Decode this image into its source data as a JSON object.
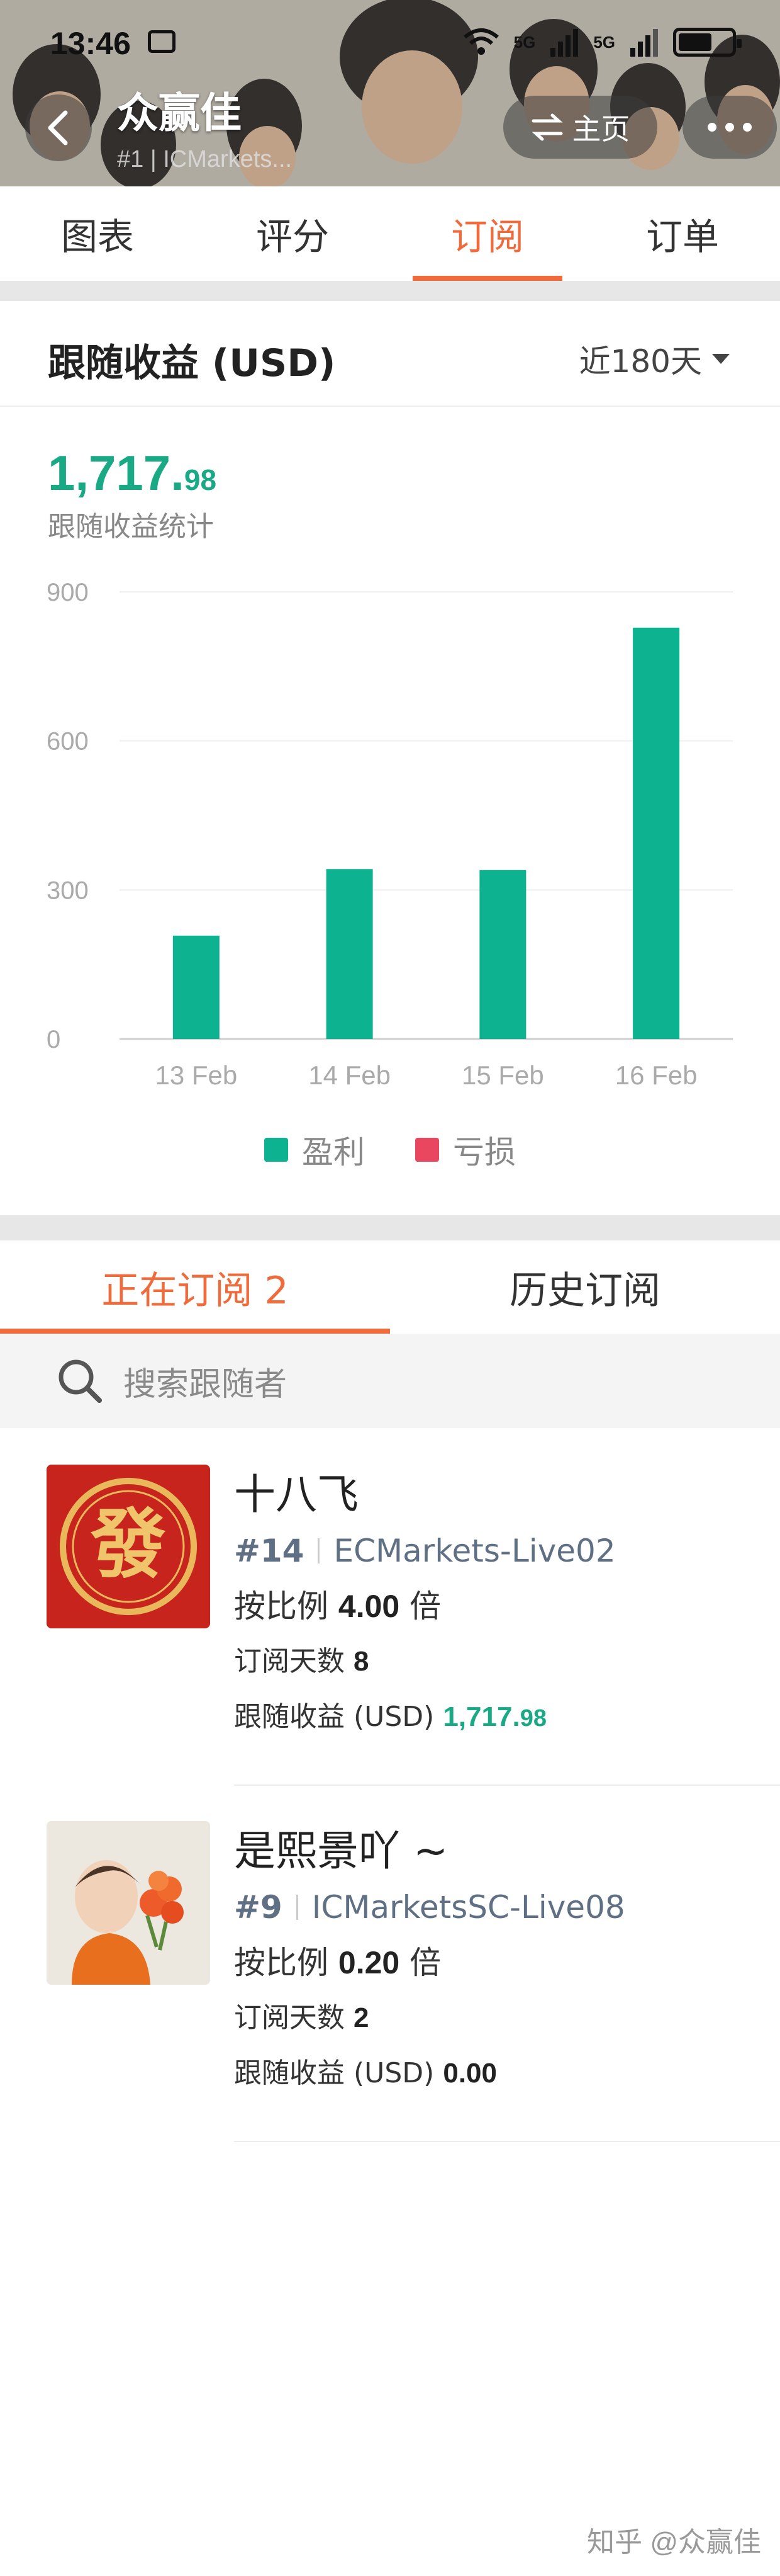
{
  "status_bar": {
    "time": "13:46",
    "network_1": "5G",
    "network_2": "5G"
  },
  "header": {
    "title": "众赢佳",
    "subtitle": "#1 | ICMarkets...",
    "home_label": "主页"
  },
  "tabs": [
    "图表",
    "评分",
    "订阅",
    "订单"
  ],
  "active_tab": 2,
  "earnings": {
    "heading": "跟随收益 (USD)",
    "range": "近180天",
    "total_int": "1,717.",
    "total_dec": "98",
    "total_label": "跟随收益统计"
  },
  "chart_data": {
    "type": "bar",
    "categories": [
      "13 Feb",
      "14 Feb",
      "15 Feb",
      "16 Feb"
    ],
    "series": [
      {
        "name": "盈利",
        "values": [
          208,
          342,
          340,
          828
        ],
        "color": "#0db390"
      },
      {
        "name": "亏损",
        "values": [
          0,
          0,
          0,
          0
        ],
        "color": "#e8475f"
      }
    ],
    "yticks": [
      0,
      300,
      600,
      900
    ],
    "ylim": [
      0,
      900
    ],
    "grid": true,
    "legend": "bottom-center"
  },
  "sub_tabs": {
    "current": "正在订阅 2",
    "history": "历史订阅"
  },
  "search": {
    "placeholder": "搜索跟随者"
  },
  "subscribers": [
    {
      "name": "十八飞",
      "rank": "#14",
      "broker": "ECMarkets-Live02",
      "ratio_label": "按比例",
      "ratio_value": "4.00",
      "ratio_unit": "倍",
      "days_label": "订阅天数",
      "days_value": "8",
      "profit_label": "跟随收益 (USD)",
      "profit_int": "1,717.",
      "profit_dec": "98",
      "avatar_text": "發"
    },
    {
      "name": "是熙景吖 ~",
      "rank": "#9",
      "broker": "ICMarketsSC-Live08",
      "ratio_label": "按比例",
      "ratio_value": "0.20",
      "ratio_unit": "倍",
      "days_label": "订阅天数",
      "days_value": "2",
      "profit_label": "跟随收益 (USD)",
      "profit_int": "0.00",
      "profit_dec": ""
    }
  ],
  "watermark": "知乎 @众赢佳"
}
